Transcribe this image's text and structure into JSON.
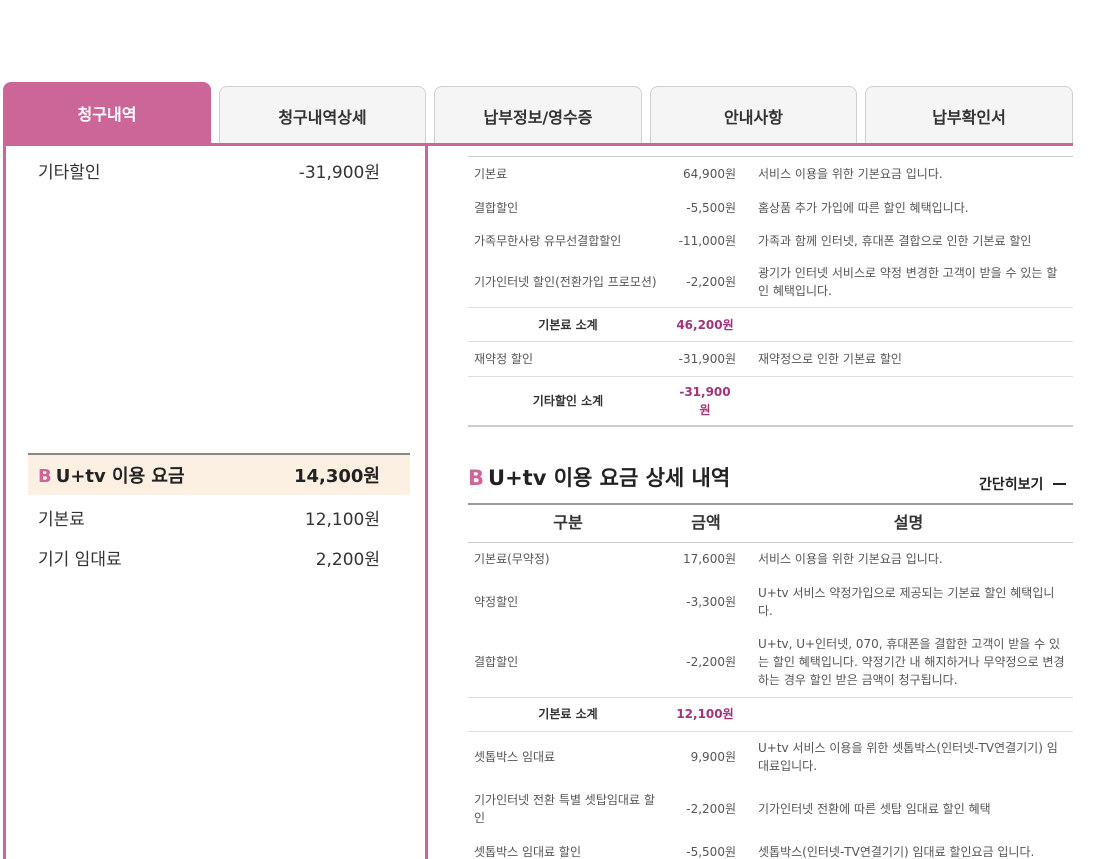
{
  "tabs": [
    {
      "label": "청구내역",
      "active": true
    },
    {
      "label": "청구내역상세",
      "active": false
    },
    {
      "label": "납부정보/영수증",
      "active": false
    },
    {
      "label": "안내사항",
      "active": false
    },
    {
      "label": "납부확인서",
      "active": false
    }
  ],
  "left": {
    "other_discount": {
      "label": "기타할인",
      "amount": "-31,900원"
    },
    "utv_section": {
      "prefix": "B",
      "title": "U+tv 이용 요금",
      "amount": "14,300원"
    },
    "utv_items": [
      {
        "label": "기본료",
        "amount": "12,100원"
      },
      {
        "label": "기기 임대료",
        "amount": "2,200원"
      }
    ]
  },
  "internet_table": {
    "rows": [
      {
        "name": "기본료",
        "amount": "64,900원",
        "desc": "서비스 이용을 위한 기본요금 입니다."
      },
      {
        "name": "결합할인",
        "amount": "-5,500원",
        "desc": "홈상품 추가 가입에 따른 할인 혜택입니다."
      },
      {
        "name": "가족무한사랑 유무선결합할인",
        "amount": "-11,000원",
        "desc": "가족과 함께 인터넷, 휴대폰 결합으로 인한 기본료 할인"
      },
      {
        "name": "기가인터넷 할인(전환가입 프로모션)",
        "amount": "-2,200원",
        "desc": "광기가 인터넷 서비스로 약정 변경한 고객이 받을 수 있는 할인 혜택입니다."
      }
    ],
    "subtotal1": {
      "label": "기본료 소계",
      "amount": "46,200원"
    },
    "row_after": {
      "name": "재약정 할인",
      "amount": "-31,900원",
      "desc": "재약정으로 인한 기본료 할인"
    },
    "subtotal2": {
      "label": "기타할인 소계",
      "amount": "-31,900원"
    }
  },
  "utv_detail": {
    "prefix": "B",
    "title": "U+tv 이용 요금 상세 내역",
    "toggle_label": "간단히보기",
    "headers": [
      "구분",
      "금액",
      "설명"
    ],
    "rows": [
      {
        "name": "기본료(무약정)",
        "amount": "17,600원",
        "desc": "서비스 이용을 위한 기본요금 입니다."
      },
      {
        "name": "약정할인",
        "amount": "-3,300원",
        "desc": "U+tv 서비스 약정가입으로 제공되는 기본료 할인 혜택입니다."
      },
      {
        "name": "결합할인",
        "amount": "-2,200원",
        "desc": "U+tv, U+인터넷, 070, 휴대폰을 결합한 고객이 받을 수 있는 할인 혜택입니다. 약정기간 내 해지하거나 무약정으로 변경하는 경우 할인 받은 금액이 청구됩니다."
      }
    ],
    "subtotal": {
      "label": "기본료 소계",
      "amount": "12,100원"
    },
    "rows2": [
      {
        "name": "셋톱박스 임대료",
        "amount": "9,900원",
        "desc": "U+tv 서비스 이용을 위한 셋톱박스(인터넷-TV연결기기) 임대료입니다."
      },
      {
        "name": "기가인터넷 전환 특별 셋탑임대료 할인",
        "amount": "-2,200원",
        "desc": "기가인터넷 전환에 따른 셋탑 임대료 할인 혜택"
      },
      {
        "name": "셋톱박스 임대료 할인",
        "amount": "-5,500원",
        "desc": "셋톱박스(인터넷-TV연결기기) 임대료 할인요금 입니다."
      }
    ]
  }
}
